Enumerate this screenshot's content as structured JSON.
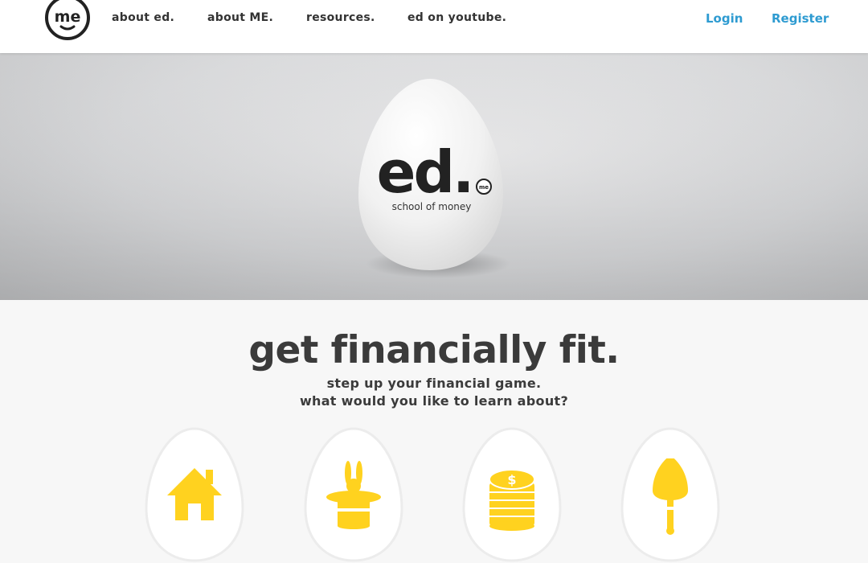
{
  "header": {
    "logo_text": "me",
    "nav": [
      {
        "label": "about ed."
      },
      {
        "label": "about ME."
      },
      {
        "label": "resources."
      },
      {
        "label": "ed on youtube."
      }
    ],
    "login_label": "Login",
    "register_label": "Register"
  },
  "hero": {
    "egg_title": "ed.",
    "egg_badge": "me",
    "egg_subtitle": "school of money"
  },
  "main": {
    "headline": "get financially fit.",
    "subline_1": "step up your financial game.",
    "subline_2": "what would you like to learn about?",
    "topics": [
      {
        "icon": "house-icon"
      },
      {
        "icon": "magic-hat-icon"
      },
      {
        "icon": "coin-stack-icon"
      },
      {
        "icon": "shovel-icon"
      }
    ]
  },
  "colors": {
    "accent_blue": "#2e9bd1",
    "icon_yellow": "#ffd21f",
    "text_dark": "#3b3b3b"
  }
}
